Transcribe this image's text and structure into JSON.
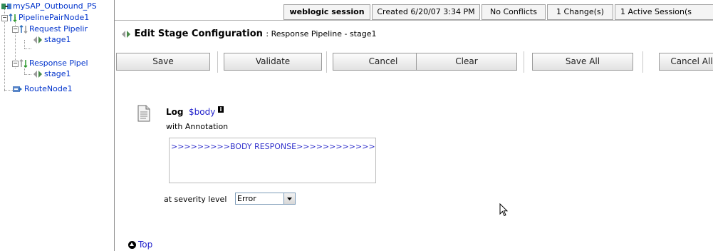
{
  "tree": {
    "root": "mySAP_Outbound_PS",
    "pipeline_pair": "PipelinePairNode1",
    "request_pipeline": "Request Pipelir",
    "request_stage": "stage1",
    "response_pipeline": "Response Pipel",
    "response_stage": "stage1",
    "route_node": "RouteNode1"
  },
  "status": {
    "session": "weblogic session",
    "created": "Created 6/20/07 3:34 PM",
    "conflicts": "No Conflicts",
    "changes": "1 Change(s)",
    "active_sessions": "1 Active Session(s"
  },
  "title": {
    "main": "Edit Stage Configuration",
    "sub": ": Response Pipeline - stage1"
  },
  "toolbar": {
    "save": "Save",
    "validate": "Validate",
    "cancel": "Cancel",
    "clear": "Clear",
    "save_all": "Save All",
    "cancel_all": "Cancel All"
  },
  "log": {
    "label": "Log",
    "variable": "$body",
    "info_icon": "i",
    "annotation_label": "with Annotation",
    "annotation_text": ">>>>>>>>>BODY RESPONSE>>>>>>>>>>>>",
    "severity_label": "at severity level",
    "severity_value": "Error"
  },
  "footer": {
    "top_link": "Top"
  },
  "icons": {
    "root": "service-icon",
    "pipeline_pair": "pipeline-pair-icon",
    "stage": "stage-icon",
    "route": "route-node-icon",
    "log": "document-icon",
    "top": "up-arrow-circle-icon"
  },
  "colors": {
    "link": "#2222cc",
    "tree_link": "#0033cc",
    "border": "#a0a0a0"
  }
}
